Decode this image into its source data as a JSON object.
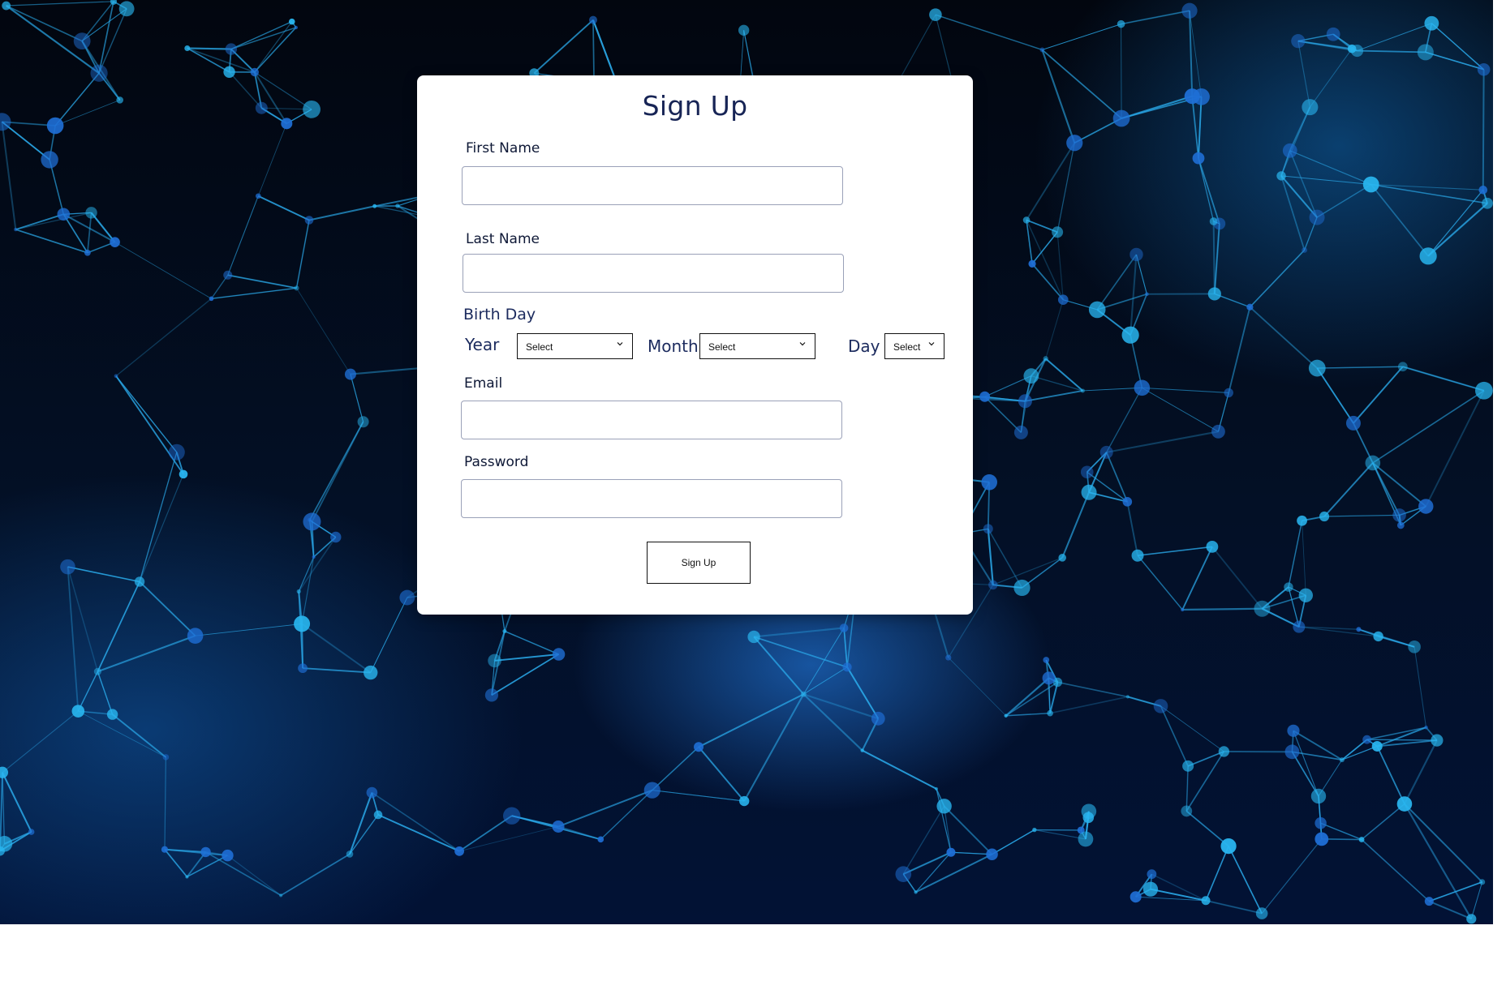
{
  "form": {
    "title": "Sign Up",
    "first_name": {
      "label": "First Name",
      "value": "",
      "placeholder": ""
    },
    "last_name": {
      "label": "Last Name",
      "value": "",
      "placeholder": ""
    },
    "birthday": {
      "label": "Birth Day",
      "year": {
        "label": "Year",
        "selected": "Select"
      },
      "month": {
        "label": "Month",
        "selected": "Select"
      },
      "day": {
        "label": "Day",
        "selected": "Select"
      }
    },
    "email": {
      "label": "Email",
      "value": "",
      "placeholder": ""
    },
    "password": {
      "label": "Password",
      "value": "",
      "placeholder": ""
    },
    "submit_label": "Sign Up"
  },
  "colors": {
    "title": "#172455",
    "card": "#ffffff",
    "background": "#031026",
    "network": "#2aa8e8"
  },
  "icons": [
    "chevron-down-icon"
  ]
}
